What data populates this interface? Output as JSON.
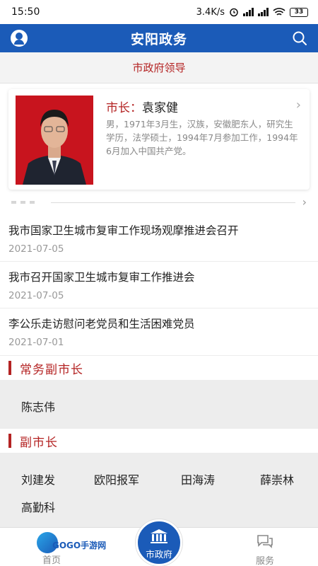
{
  "status_bar": {
    "time": "15:50",
    "net_speed": "3.4K/s",
    "battery": "33"
  },
  "app_bar": {
    "title": "安阳政务",
    "left_icon": "user-icon",
    "right_icon": "search-icon"
  },
  "section_header": "市政府领导",
  "leader": {
    "title_label": "市长：",
    "name": "袁家健",
    "bio": "男，1971年3月生，汉族，安徽肥东人，研究生学历，法学硕士，1994年7月参加工作，1994年6月加入中国共产党。"
  },
  "news": [
    {
      "title": "我市国家卫生城市复审工作现场观摩推进会召开",
      "date": "2021-07-05"
    },
    {
      "title": "我市召开国家卫生城市复审工作推进会",
      "date": "2021-07-05"
    },
    {
      "title": "李公乐走访慰问老党员和生活困难党员",
      "date": "2021-07-01"
    }
  ],
  "executive_vice_mayors": {
    "label": "常务副市长",
    "names": [
      "陈志伟"
    ]
  },
  "vice_mayors": {
    "label": "副市长",
    "names": [
      "刘建发",
      "欧阳报军",
      "田海涛",
      "薛崇林",
      "高勤科"
    ]
  },
  "tab_bar": {
    "home_label": "首页",
    "home_overlay": "GOGO手游网",
    "center_label": "市政府",
    "service_label": "服务"
  },
  "colors": {
    "primary": "#1b5bb8",
    "accent": "#b42323"
  }
}
